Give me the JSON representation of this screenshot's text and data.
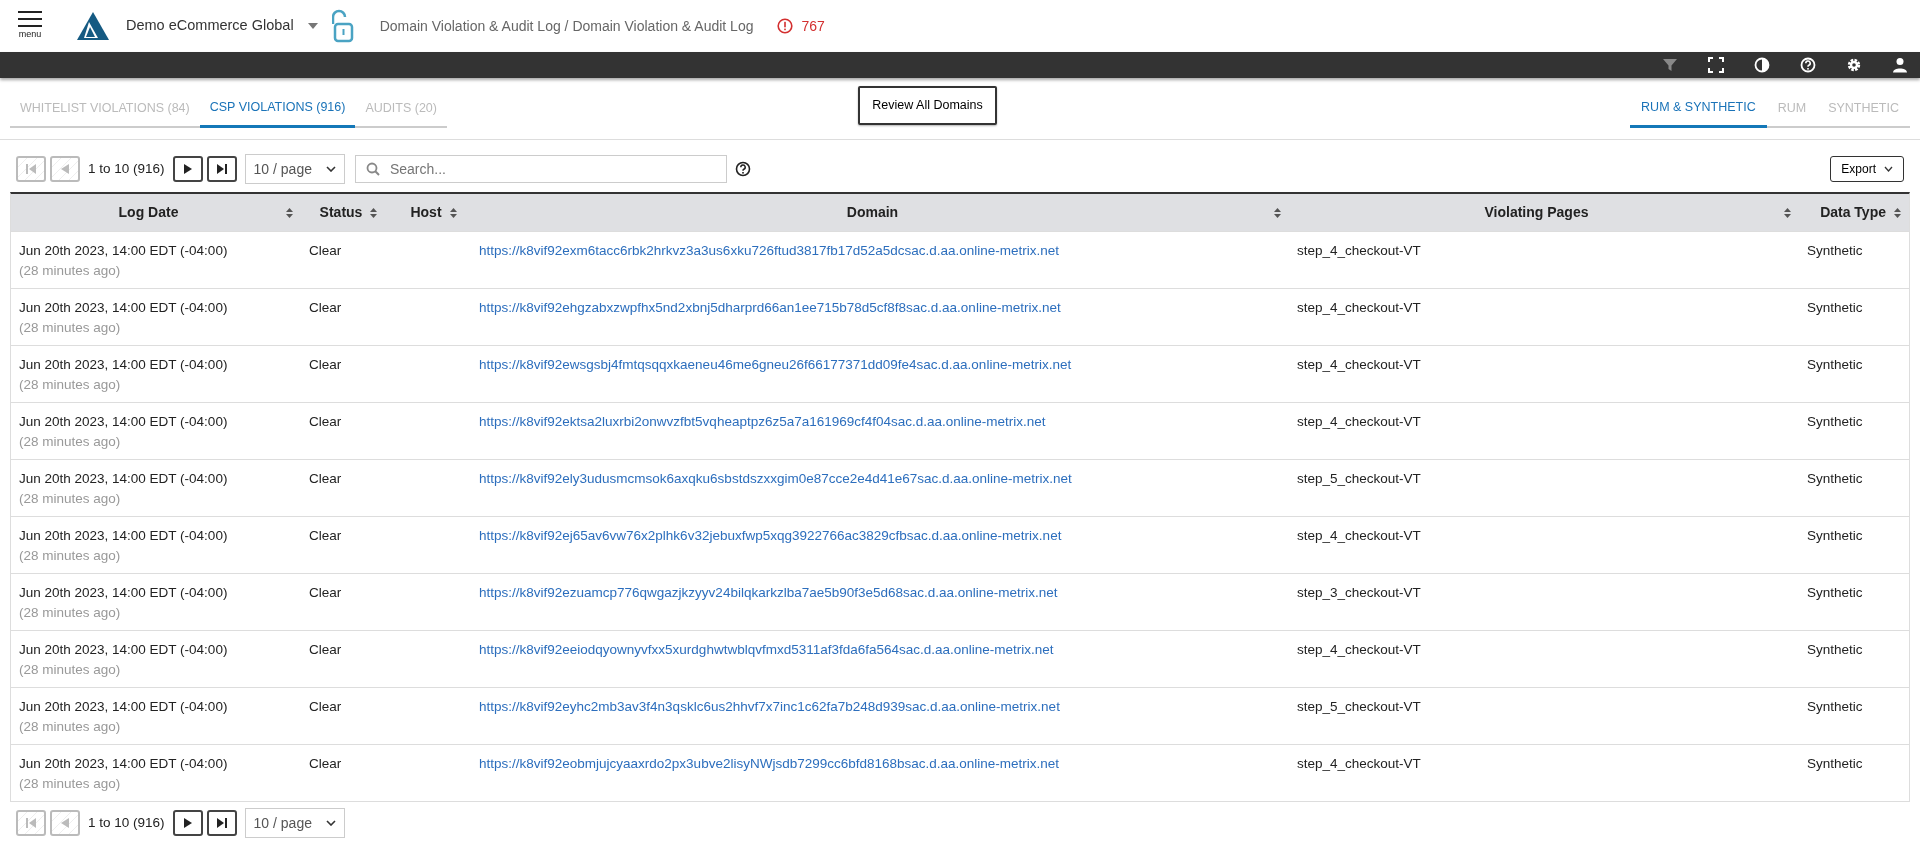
{
  "header": {
    "menu_label": "menu",
    "org": "Demo eCommerce Global",
    "breadcrumb": "Domain Violation & Audit Log / Domain Violation & Audit Log",
    "alert_count": "767"
  },
  "tabs": [
    {
      "label": "WHITELIST VIOLATIONS (84)",
      "selected": false
    },
    {
      "label": "CSP VIOLATIONS (916)",
      "selected": true
    },
    {
      "label": "AUDITS (20)",
      "selected": false
    }
  ],
  "review_button": "Review All Domains",
  "source_tabs": [
    {
      "label": "RUM & SYNTHETIC",
      "selected": true
    },
    {
      "label": "RUM",
      "selected": false
    },
    {
      "label": "SYNTHETIC",
      "selected": false
    }
  ],
  "pager_top": {
    "range": "1 to 10 (916)",
    "page_size": "10 / page",
    "buttons": [
      {
        "kind": "first",
        "disabled": true
      },
      {
        "kind": "prev",
        "disabled": true
      },
      {
        "kind": "next",
        "disabled": false
      },
      {
        "kind": "last",
        "disabled": false
      }
    ]
  },
  "search": {
    "placeholder": "Search..."
  },
  "export_button": "Export",
  "table": {
    "columns": [
      "Log Date",
      "Status",
      "Host",
      "Domain",
      "Violating Pages",
      "Data Type"
    ],
    "rows": [
      {
        "date": "Jun 20th 2023, 14:00 EDT (-04:00)",
        "ago": "(28 minutes ago)",
        "status": "Clear",
        "domain": "https://k8vif92exm6tacc6rbk2hrkvz3a3us6xku726ftud3817fb17d52a5dcsac.d.aa.online-metrix.net",
        "pages": "step_4_checkout-VT",
        "data_type": "Synthetic"
      },
      {
        "date": "Jun 20th 2023, 14:00 EDT (-04:00)",
        "ago": "(28 minutes ago)",
        "status": "Clear",
        "domain": "https://k8vif92ehgzabxzwpfhx5nd2xbnj5dharprd66an1ee715b78d5cf8f8sac.d.aa.online-metrix.net",
        "pages": "step_4_checkout-VT",
        "data_type": "Synthetic"
      },
      {
        "date": "Jun 20th 2023, 14:00 EDT (-04:00)",
        "ago": "(28 minutes ago)",
        "status": "Clear",
        "domain": "https://k8vif92ewsgsbj4fmtqsqqxkaeneu46me6gneu26f66177371dd09fe4sac.d.aa.online-metrix.net",
        "pages": "step_4_checkout-VT",
        "data_type": "Synthetic"
      },
      {
        "date": "Jun 20th 2023, 14:00 EDT (-04:00)",
        "ago": "(28 minutes ago)",
        "status": "Clear",
        "domain": "https://k8vif92ektsa2luxrbi2onwvzfbt5vqheaptpz6z5a7a161969cf4f04sac.d.aa.online-metrix.net",
        "pages": "step_4_checkout-VT",
        "data_type": "Synthetic"
      },
      {
        "date": "Jun 20th 2023, 14:00 EDT (-04:00)",
        "ago": "(28 minutes ago)",
        "status": "Clear",
        "domain": "https://k8vif92ely3udusmcmsok6axqku6sbstdszxxgim0e87cce2e4d41e67sac.d.aa.online-metrix.net",
        "pages": "step_5_checkout-VT",
        "data_type": "Synthetic"
      },
      {
        "date": "Jun 20th 2023, 14:00 EDT (-04:00)",
        "ago": "(28 minutes ago)",
        "status": "Clear",
        "domain": "https://k8vif92ej65av6vw76x2plhk6v32jebuxfwp5xqg3922766ac3829cfbsac.d.aa.online-metrix.net",
        "pages": "step_4_checkout-VT",
        "data_type": "Synthetic"
      },
      {
        "date": "Jun 20th 2023, 14:00 EDT (-04:00)",
        "ago": "(28 minutes ago)",
        "status": "Clear",
        "domain": "https://k8vif92ezuamcp776qwgazjkzyyv24bilqkarkzlba7ae5b90f3e5d68sac.d.aa.online-metrix.net",
        "pages": "step_3_checkout-VT",
        "data_type": "Synthetic"
      },
      {
        "date": "Jun 20th 2023, 14:00 EDT (-04:00)",
        "ago": "(28 minutes ago)",
        "status": "Clear",
        "domain": "https://k8vif92eeiodqyownyvfxx5xurdghwtwblqvfmxd5311af3fda6fa564sac.d.aa.online-metrix.net",
        "pages": "step_4_checkout-VT",
        "data_type": "Synthetic"
      },
      {
        "date": "Jun 20th 2023, 14:00 EDT (-04:00)",
        "ago": "(28 minutes ago)",
        "status": "Clear",
        "domain": "https://k8vif92eyhc2mb3av3f4n3qsklc6us2hhvf7x7inc1c62fa7b248d939sac.d.aa.online-metrix.net",
        "pages": "step_5_checkout-VT",
        "data_type": "Synthetic"
      },
      {
        "date": "Jun 20th 2023, 14:00 EDT (-04:00)",
        "ago": "(28 minutes ago)",
        "status": "Clear",
        "domain": "https://k8vif92eobmjujcyaaxrdo2px3ubve2lisyNWjsdb7299cc6bfd8168bsac.d.aa.online-metrix.net",
        "pages": "step_4_checkout-VT",
        "data_type": "Synthetic"
      }
    ]
  },
  "pager_bottom": {
    "range": "1 to 10 (916)",
    "page_size": "10 / page",
    "buttons": [
      {
        "kind": "first",
        "disabled": true
      },
      {
        "kind": "prev",
        "disabled": true
      },
      {
        "kind": "next",
        "disabled": false
      },
      {
        "kind": "last",
        "disabled": false
      }
    ]
  }
}
